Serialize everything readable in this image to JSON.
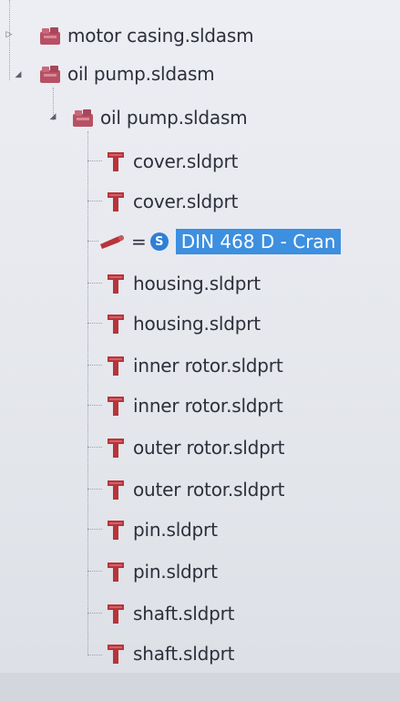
{
  "tree": {
    "colors": {
      "assembly_icon": "#b85064",
      "part_icon": "#b8343a",
      "selection": "#3d8fe0",
      "badge": "#2f7fd6"
    },
    "nodes": [
      {
        "label": "motor casing.sldasm",
        "icon": "assembly-icon",
        "expander": "collapsed"
      },
      {
        "label": "oil pump.sldasm",
        "icon": "assembly-icon",
        "expander": "expanded"
      },
      {
        "label": "oil pump.sldasm",
        "icon": "assembly-icon",
        "expander": "expanded"
      },
      {
        "label": "cover.sldprt",
        "icon": "part-icon"
      },
      {
        "label": "cover.sldprt",
        "icon": "part-icon"
      },
      {
        "label": "DIN 468 D - Cran",
        "icon": "toolbox-part-icon",
        "prefix": "=",
        "badge": "S",
        "selected": true
      },
      {
        "label": "housing.sldprt",
        "icon": "part-icon"
      },
      {
        "label": "housing.sldprt",
        "icon": "part-icon"
      },
      {
        "label": "inner rotor.sldprt",
        "icon": "part-icon"
      },
      {
        "label": "inner rotor.sldprt",
        "icon": "part-icon"
      },
      {
        "label": "outer rotor.sldprt",
        "icon": "part-icon"
      },
      {
        "label": "outer rotor.sldprt",
        "icon": "part-icon"
      },
      {
        "label": "pin.sldprt",
        "icon": "part-icon"
      },
      {
        "label": "pin.sldprt",
        "icon": "part-icon"
      },
      {
        "label": "shaft.sldprt",
        "icon": "part-icon"
      },
      {
        "label": "shaft.sldprt",
        "icon": "part-icon"
      }
    ]
  }
}
